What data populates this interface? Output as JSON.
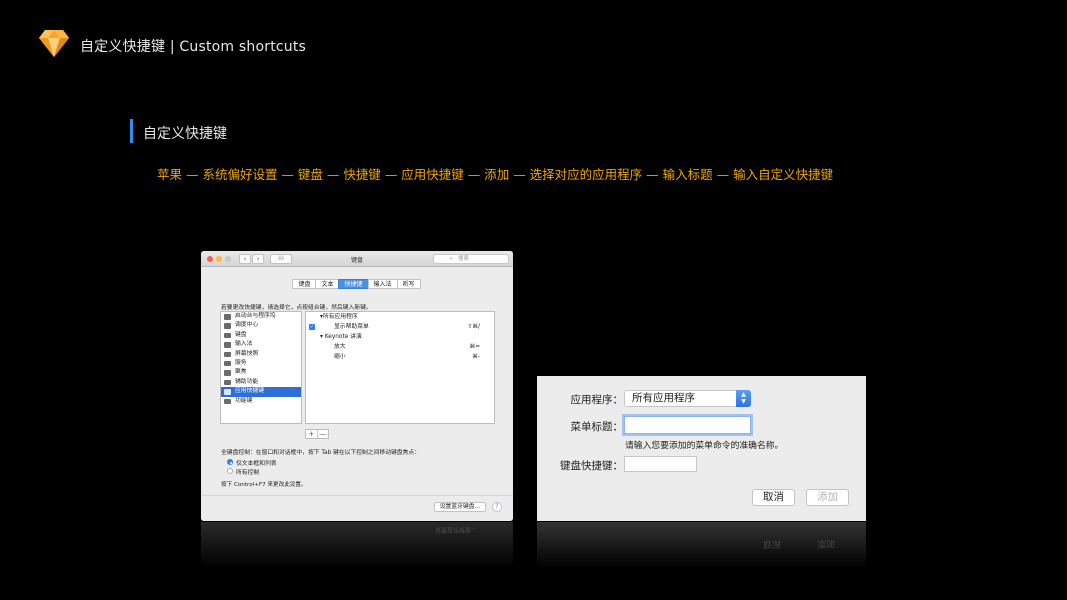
{
  "header": {
    "title": "自定义快捷键 | Custom shortcuts",
    "logo_icon": "sketch-diamond-icon",
    "logo_color": "#f7a62b"
  },
  "section": {
    "title": "自定义快捷键",
    "bar_color": "#2f8ef2",
    "path": "苹果 — 系统偏好设置 — 键盘 — 快捷键 — 应用快捷键 — 添加 — 选择对应的应用程序 — 输入标题 — 输入自定义快捷键",
    "path_color": "#f0a500"
  },
  "prefs_window": {
    "title": "键盘",
    "search_placeholder": "搜索",
    "tabs": [
      {
        "label": "键盘",
        "active": false
      },
      {
        "label": "文本",
        "active": false
      },
      {
        "label": "快捷键",
        "active": true
      },
      {
        "label": "输入法",
        "active": false
      },
      {
        "label": "听写",
        "active": false
      }
    ],
    "hint": "若要更改快捷键，请选择它，点按组合键，然后键入新键。",
    "categories": [
      {
        "label": "启动台与程序坞",
        "selected": false
      },
      {
        "label": "调度中心",
        "selected": false
      },
      {
        "label": "键盘",
        "selected": false
      },
      {
        "label": "输入法",
        "selected": false
      },
      {
        "label": "屏幕快照",
        "selected": false
      },
      {
        "label": "服务",
        "selected": false
      },
      {
        "label": "聚焦",
        "selected": false
      },
      {
        "label": "辅助功能",
        "selected": false
      },
      {
        "label": "应用快捷键",
        "selected": true
      },
      {
        "label": "功能键",
        "selected": false
      }
    ],
    "shortcuts": [
      {
        "label": "▾所有应用程序",
        "key": "",
        "indent": 1,
        "checked": false
      },
      {
        "label": "显示帮助菜单",
        "key": "⇧⌘/",
        "indent": 2,
        "checked": true
      },
      {
        "label": "▾ Keynote 讲演",
        "key": "",
        "indent": 1,
        "checked": false
      },
      {
        "label": "放大",
        "key": "⌘=",
        "indent": 2,
        "checked": false
      },
      {
        "label": "缩小",
        "key": "⌘-",
        "indent": 2,
        "checked": false
      }
    ],
    "add_remove": [
      "+",
      "—"
    ],
    "full_keyboard": "全键盘控制：在窗口和对话框中，按下 Tab 键在以下控制之间移动键盘焦点：",
    "radio_options": [
      {
        "label": "仅文本框和列表",
        "selected": true
      },
      {
        "label": "所有控制",
        "selected": false
      }
    ],
    "control_hint": "按下 Control+F7 来更改此设置。",
    "bluetooth_button": "设置蓝牙键盘...",
    "help_button": "?"
  },
  "dialog": {
    "app_label": "应用程序：",
    "app_value": "所有应用程序",
    "menu_title_label": "菜单标题：",
    "menu_title_value": "",
    "menu_title_hint": "请输入您要添加的菜单命令的准确名称。",
    "shortcut_label": "键盘快捷键：",
    "shortcut_value": "",
    "cancel_button": "取消",
    "add_button": "添加"
  }
}
